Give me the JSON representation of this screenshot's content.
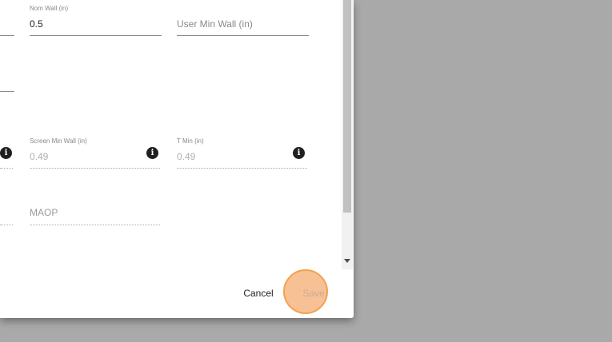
{
  "form": {
    "nom_wall": {
      "label": "Nom Wall (in)",
      "value": "0.5"
    },
    "user_min_wall": {
      "placeholder": "User Min Wall (in)"
    },
    "screen_min_wall": {
      "label": "Screen Min Wall (in)",
      "value": "0.49"
    },
    "t_min": {
      "label": "T Min (in)",
      "value": "0.49"
    },
    "maop": {
      "placeholder": "MAOP"
    }
  },
  "actions": {
    "cancel_label": "Cancel",
    "save_label": "Save"
  },
  "icons": {
    "info": "info-icon"
  },
  "colors": {
    "overlay": "#a9a9a9",
    "dialog": "#ffffff",
    "highlight_fill": "#f7ba8a",
    "highlight_border": "#f1a24f"
  }
}
